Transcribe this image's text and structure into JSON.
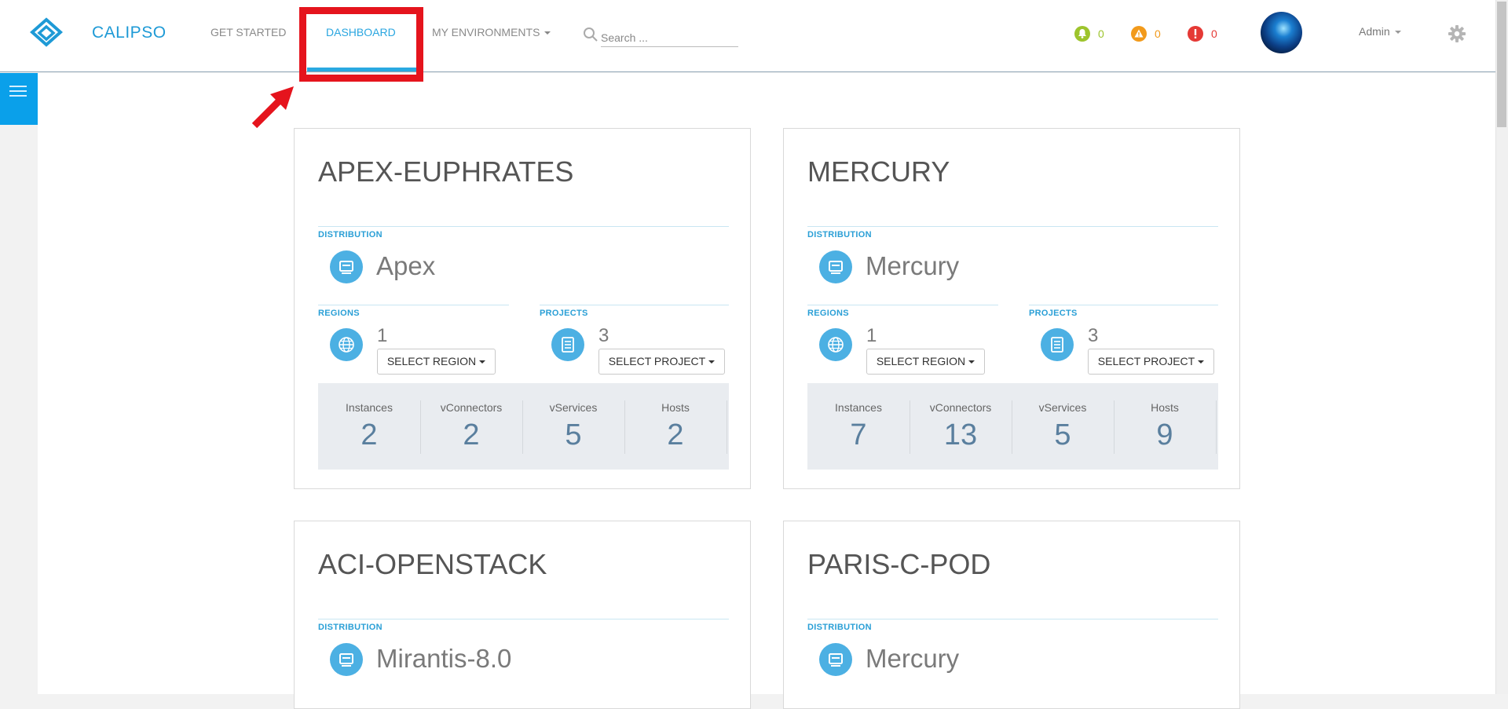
{
  "header": {
    "brand": "CALIPSO",
    "nav": {
      "get_started": "GET STARTED",
      "dashboard": "DASHBOARD",
      "my_environments": "MY ENVIRONMENTS"
    },
    "search": {
      "placeholder": "Search ..."
    },
    "alerts": [
      {
        "icon": "bell-icon",
        "color": "#9dc42c",
        "count": "0"
      },
      {
        "icon": "warning-icon",
        "color": "#f29a1b",
        "count": "0"
      },
      {
        "icon": "error-icon",
        "color": "#e53935",
        "count": "0"
      }
    ],
    "user": "Admin"
  },
  "labels": {
    "distribution": "DISTRIBUTION",
    "regions": "REGIONS",
    "projects": "PROJECTS",
    "select_region": "SELECT REGION",
    "select_project": "SELECT PROJECT",
    "instances": "Instances",
    "vconnectors": "vConnectors",
    "vservices": "vServices",
    "hosts": "Hosts"
  },
  "environments": [
    {
      "name": "APEX-EUPHRATES",
      "distribution": "Apex",
      "regions": "1",
      "projects": "3",
      "stats": {
        "instances": "2",
        "vconnectors": "2",
        "vservices": "5",
        "hosts": "2"
      }
    },
    {
      "name": "MERCURY",
      "distribution": "Mercury",
      "regions": "1",
      "projects": "3",
      "stats": {
        "instances": "7",
        "vconnectors": "13",
        "vservices": "5",
        "hosts": "9"
      }
    },
    {
      "name": "ACI-OPENSTACK",
      "distribution": "Mirantis-8.0"
    },
    {
      "name": "PARIS-C-POD",
      "distribution": "Mercury"
    }
  ],
  "colors": {
    "accent": "#2aa6e0",
    "highlight": "#e5141d"
  }
}
